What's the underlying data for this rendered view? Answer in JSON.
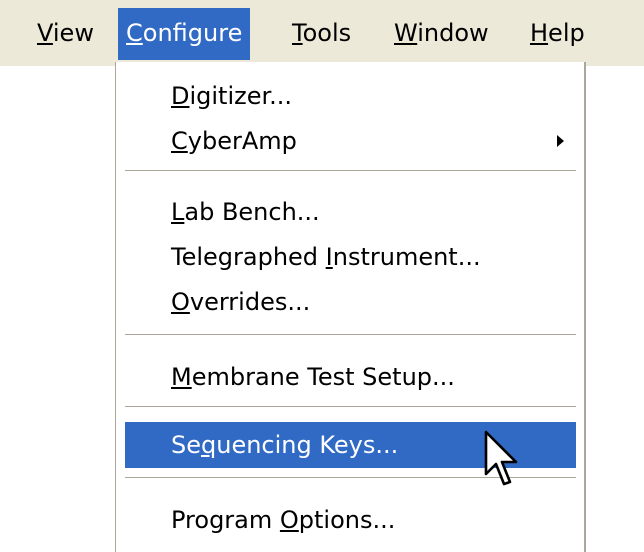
{
  "menubar": {
    "items": [
      {
        "key": "V",
        "rest": "iew"
      },
      {
        "key": "C",
        "rest": "onfigure"
      },
      {
        "key": "T",
        "rest": "ools"
      },
      {
        "key": "W",
        "rest": "indow"
      },
      {
        "key": "H",
        "rest": "elp"
      }
    ]
  },
  "configure_menu": {
    "items": [
      {
        "pre": "",
        "key": "D",
        "post": "igitizer..."
      },
      {
        "pre": "",
        "key": "C",
        "post": "yberAmp"
      },
      {
        "pre": "",
        "key": "L",
        "post": "ab Bench..."
      },
      {
        "pre": "Telegraphed ",
        "key": "I",
        "post": "nstrument..."
      },
      {
        "pre": "",
        "key": "O",
        "post": "verrides..."
      },
      {
        "pre": "",
        "key": "M",
        "post": "embrane Test Setup..."
      },
      {
        "pre": "Se",
        "key": "q",
        "post": "uencing Keys..."
      },
      {
        "pre": "Program ",
        "key": "O",
        "post": "ptions..."
      }
    ]
  },
  "colors": {
    "menubar_background": "#ece9d8",
    "selection": "#316ac5"
  },
  "icons": {
    "submenu_arrow": "triangle-right-icon",
    "cursor": "mouse-pointer-icon"
  }
}
